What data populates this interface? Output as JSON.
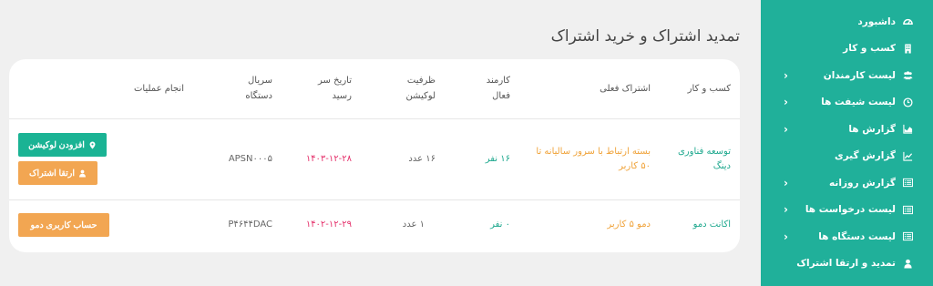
{
  "page": {
    "title": "تمدید اشتراک و خرید اشتراک"
  },
  "sidebar": {
    "items": [
      {
        "label": "داشبورد",
        "icon": "dashboard-icon",
        "chevron": ""
      },
      {
        "label": "کسب و کار",
        "icon": "building-icon",
        "chevron": ""
      },
      {
        "label": "لیست کارمندان",
        "icon": "users-icon",
        "chevron": "‹"
      },
      {
        "label": "لیست شیفت ها",
        "icon": "clock-icon",
        "chevron": "‹"
      },
      {
        "label": "گزارش ها",
        "icon": "area-chart-icon",
        "chevron": "‹"
      },
      {
        "label": "گزارش گیری",
        "icon": "line-chart-icon",
        "chevron": ""
      },
      {
        "label": "گزارش روزانه",
        "icon": "list-icon",
        "chevron": "‹"
      },
      {
        "label": "لیست درخواست ها",
        "icon": "list-icon",
        "chevron": "‹"
      },
      {
        "label": "لیست دستگاه ها",
        "icon": "list-icon",
        "chevron": "‹"
      },
      {
        "label": "تمدید و ارتقا اشتراک",
        "icon": "user-icon",
        "chevron": ""
      }
    ]
  },
  "table": {
    "headers": {
      "business": "کسب و کار",
      "subscription": "اشتراک فعلی",
      "active_staff_line1": "کارمند",
      "active_staff_line2": "فعال",
      "location_capacity_line1": "ظرفیت",
      "location_capacity_line2": "لوکیشن",
      "due_date_line1": "تاریخ سر",
      "due_date_line2": "رسید",
      "device_serial_line1": "سریال",
      "device_serial_line2": "دستگاه",
      "operations": "انجام عملیات"
    },
    "rows": [
      {
        "business_line1": "توسعه فناوری",
        "business_line2": "دینگ",
        "subscription_line1": "بسته ارتباط با سرور سالیانه تا",
        "subscription_line2": "۵۰ کاربر",
        "active_staff": "۱۶ نفر",
        "location_capacity": "۱۶ عدد",
        "due_date": "۱۴۰۳-۱۲-۲۸",
        "device_serial": "APSN۰۰۰۵",
        "buttons": {
          "add_location": "افزودن لوکیشن",
          "upgrade": "ارتقا اشتراک"
        }
      },
      {
        "business": "اکانت دمو",
        "subscription": "دمو ۵ کاربر",
        "active_staff": "۰ نفر",
        "location_capacity": "۱ عدد",
        "due_date": "۱۴۰۲-۱۲-۲۹",
        "device_serial": "P۴۶۴۴DAC",
        "buttons": {
          "demo_account": "حساب کاربری دمو"
        }
      }
    ]
  },
  "colors": {
    "sidebar_bg": "#20b09a",
    "teal_text": "#20a98f",
    "orange_text": "#f0a33a",
    "date_text": "#e5316b",
    "green_button": "#1ab394",
    "orange_button": "#f2a652"
  }
}
